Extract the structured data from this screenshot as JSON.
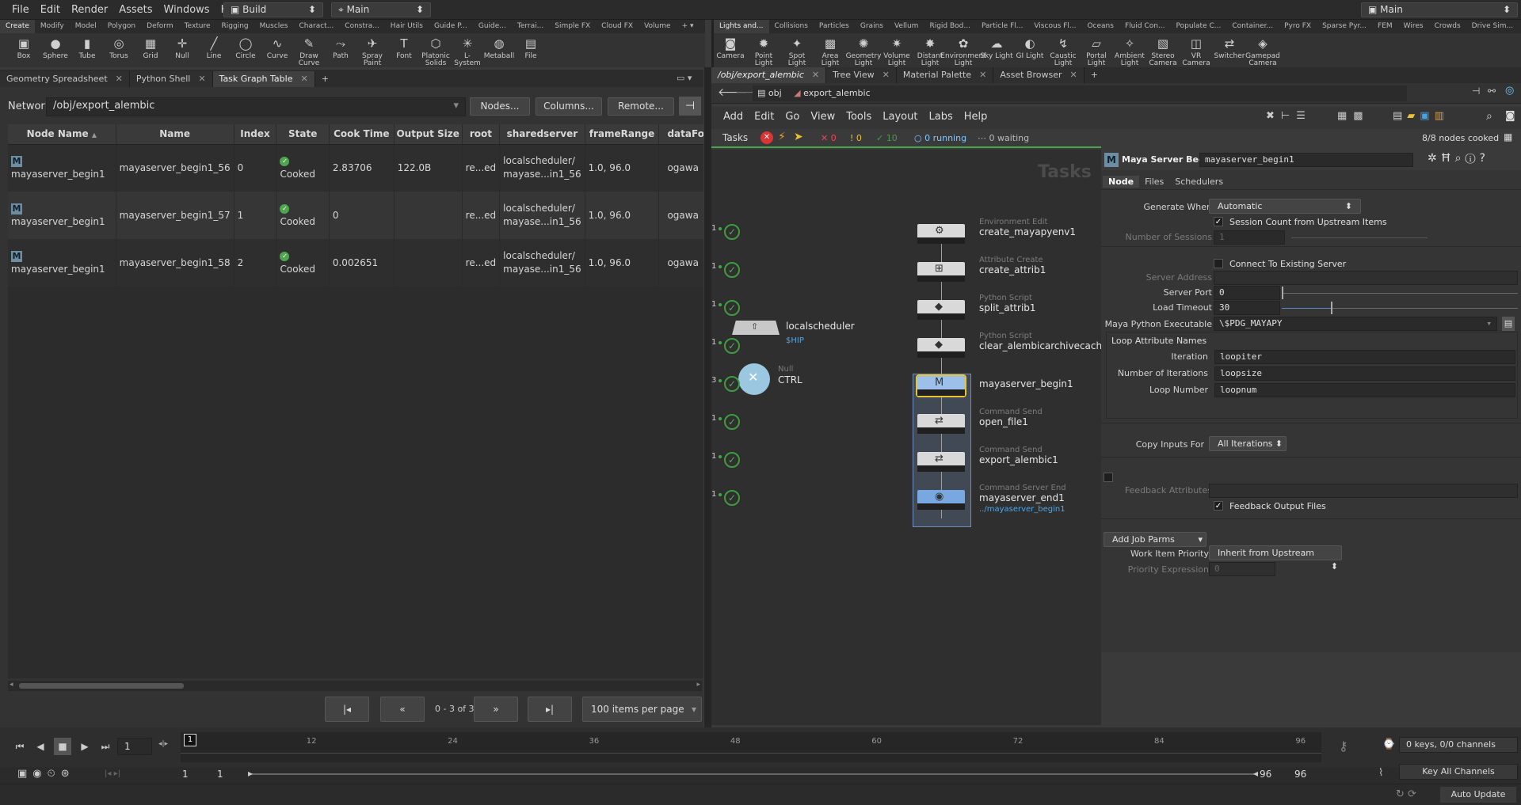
{
  "menubar": {
    "items": [
      "File",
      "Edit",
      "Render",
      "Assets",
      "Windows",
      "Help"
    ],
    "desktop": "Build",
    "context": "Main",
    "right_context": "Main"
  },
  "shelf_left": {
    "tabs": [
      "Create",
      "Modify",
      "Model",
      "Polygon",
      "Deform",
      "Texture",
      "Rigging",
      "Muscles",
      "Charact...",
      "Constra...",
      "Hair Utils",
      "Guide P...",
      "Guide...",
      "Terrai...",
      "Simple FX",
      "Cloud FX",
      "Volume"
    ],
    "tools": [
      "Box",
      "Sphere",
      "Tube",
      "Torus",
      "Grid",
      "Null",
      "Line",
      "Circle",
      "Curve",
      "Draw Curve",
      "Path",
      "Spray Paint",
      "Font",
      "Platonic Solids",
      "L-System",
      "Metaball",
      "File"
    ]
  },
  "shelf_right": {
    "tabs": [
      "Lights and...",
      "Collisions",
      "Particles",
      "Grains",
      "Vellum",
      "Rigid Bod...",
      "Particle Fl...",
      "Viscous Fl...",
      "Oceans",
      "Fluid Con...",
      "Populate C...",
      "Container...",
      "Pyro FX",
      "Sparse Pyr...",
      "FEM",
      "Wires",
      "Crowds",
      "Drive Sim..."
    ],
    "tools": [
      "Camera",
      "Point Light",
      "Spot Light",
      "Area Light",
      "Geometry Light",
      "Volume Light",
      "Distant Light",
      "Environment Light",
      "Sky Light",
      "GI Light",
      "Caustic Light",
      "Portal Light",
      "Ambient Light",
      "Stereo Camera",
      "VR Camera",
      "Switcher",
      "Gamepad Camera"
    ]
  },
  "left_tabs": [
    "Geometry Spreadsheet",
    "Python Shell",
    "Task Graph Table"
  ],
  "network": {
    "label": "Network",
    "path": "/obj/export_alembic",
    "buttons": [
      "Nodes...",
      "Columns...",
      "Remote..."
    ]
  },
  "table": {
    "columns": [
      "Node Name",
      "Name",
      "Index",
      "State",
      "Cook Time",
      "Output Size",
      "root",
      "sharedserver",
      "frameRange",
      "dataFo"
    ],
    "rows": [
      {
        "node": "mayaserver_begin1",
        "name": "mayaserver_begin1_56",
        "index": "0",
        "state": "Cooked",
        "cook": "2.83706",
        "size": "122.0B",
        "root": "re...ed",
        "server1": "localscheduler/",
        "server2": "mayase...in1_56",
        "range": "1.0, 96.0",
        "data": "ogawa"
      },
      {
        "node": "mayaserver_begin1",
        "name": "mayaserver_begin1_57",
        "index": "1",
        "state": "Cooked",
        "cook": "0",
        "size": "",
        "root": "re...ed",
        "server1": "localscheduler/",
        "server2": "mayase...in1_56",
        "range": "1.0, 96.0",
        "data": "ogawa"
      },
      {
        "node": "mayaserver_begin1",
        "name": "mayaserver_begin1_58",
        "index": "2",
        "state": "Cooked",
        "cook": "0.002651",
        "size": "",
        "root": "re...ed",
        "server1": "localscheduler/",
        "server2": "mayase...in1_56",
        "range": "1.0, 96.0",
        "data": "ogawa"
      }
    ]
  },
  "pager": {
    "count": "0 - 3 of 3",
    "per_page": "100 items per page"
  },
  "right_tabs": [
    "/obj/export_alembic",
    "Tree View",
    "Material Palette",
    "Asset Browser"
  ],
  "breadcrumb": {
    "root": "obj",
    "current": "export_alembic"
  },
  "net_menu": [
    "Add",
    "Edit",
    "Go",
    "View",
    "Tools",
    "Layout",
    "Labs",
    "Help"
  ],
  "tasks": {
    "label": "Tasks",
    "failed": "0",
    "warnings": "0",
    "done": "10",
    "running": "0 running",
    "waiting": "0 waiting",
    "cooked": "8/8 nodes cooked",
    "watermark": "Tasks"
  },
  "scheduler": {
    "name": "localscheduler",
    "var": "$HIP"
  },
  "ctrl": {
    "type": "Null",
    "name": "CTRL"
  },
  "nodes": [
    {
      "type": "Environment Edit",
      "name": "create_mayapyenv1",
      "count": "1"
    },
    {
      "type": "Attribute Create",
      "name": "create_attrib1",
      "count": "1"
    },
    {
      "type": "Python Script",
      "name": "split_attrib1",
      "count": "1"
    },
    {
      "type": "Python Script",
      "name": "clear_alembicarchivecache1",
      "count": "1"
    },
    {
      "type": "",
      "name": "mayaserver_begin1",
      "count": "3"
    },
    {
      "type": "Command Send",
      "name": "open_file1",
      "count": "1"
    },
    {
      "type": "Command Send",
      "name": "export_alembic1",
      "count": "1"
    },
    {
      "type": "Command Server End",
      "name": "mayaserver_end1",
      "count": "1",
      "sub": "../mayaserver_begin1"
    }
  ],
  "parms": {
    "node_type": "Maya Server Begin",
    "node_name": "mayaserver_begin1",
    "tabs": [
      "Node",
      "Files",
      "Schedulers"
    ],
    "generate_when_label": "Generate When",
    "generate_when": "Automatic",
    "session_count": "Session Count from Upstream Items",
    "num_sessions_label": "Number of Sessions",
    "num_sessions": "1",
    "connect_existing": "Connect To Existing Server",
    "server_address_label": "Server Address",
    "server_port_label": "Server Port",
    "server_port": "0",
    "load_timeout_label": "Load Timeout",
    "load_timeout": "30",
    "maya_py_label": "Maya Python Executable",
    "maya_py": "\\$PDG_MAYAPY",
    "loop_attr_label": "Loop Attribute Names",
    "iteration_label": "Iteration",
    "iteration": "loopiter",
    "num_iter_label": "Number of Iterations",
    "num_iter": "loopsize",
    "loop_num_label": "Loop Number",
    "loop_num": "loopnum",
    "copy_inputs_label": "Copy Inputs For",
    "copy_inputs": "All Iterations",
    "feedback_attr_label": "Feedback Attributes",
    "feedback_files": "Feedback Output Files",
    "add_job_parms": "Add Job Parms",
    "work_priority_label": "Work Item Priority",
    "work_priority": "Inherit from Upstream Item",
    "priority_expr_label": "Priority Expression",
    "priority_expr": "0"
  },
  "timeline": {
    "frame": "1",
    "ticks": [
      "1",
      "12",
      "24",
      "36",
      "48",
      "60",
      "72",
      "84",
      "96"
    ],
    "start": "1",
    "start2": "1",
    "end": "96",
    "end2": "96",
    "keys": "0 keys, 0/0 channels",
    "key_all": "Key All Channels",
    "auto_update": "Auto Update"
  }
}
